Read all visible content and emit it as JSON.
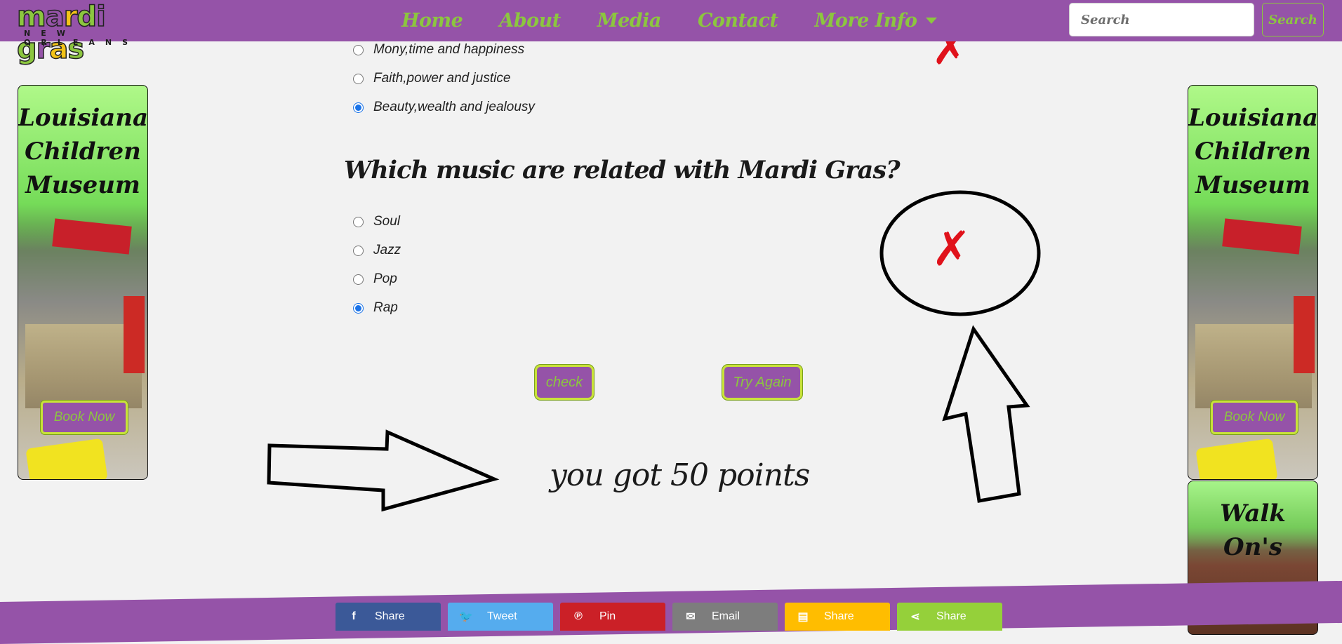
{
  "brand": {
    "logo_text": "mardi gras",
    "logo_subtitle": "NEW ORLEANS"
  },
  "nav": {
    "items": [
      {
        "label": "Home"
      },
      {
        "label": "About"
      },
      {
        "label": "Media"
      },
      {
        "label": "Contact"
      }
    ],
    "more_label": "More Info"
  },
  "search": {
    "placeholder": "Search",
    "button_label": "Search"
  },
  "ads": {
    "left": {
      "title_lines": [
        "Louisiana",
        "Children",
        "Museum"
      ],
      "button_label": "Book Now"
    },
    "right": {
      "title_lines": [
        "Louisiana",
        "Children",
        "Museum"
      ],
      "button_label": "Book Now"
    },
    "right_bottom": {
      "title": "Walk On's"
    }
  },
  "quiz": {
    "previous_options": [
      {
        "label": "Mony,time and happiness",
        "checked": false
      },
      {
        "label": "Faith,power and justice",
        "checked": false
      },
      {
        "label": "Beauty,wealth and jealousy",
        "checked": true
      }
    ],
    "question": "Which music are related with Mardi Gras?",
    "options": [
      {
        "label": "Soul",
        "checked": false
      },
      {
        "label": "Jazz",
        "checked": false
      },
      {
        "label": "Pop",
        "checked": false
      },
      {
        "label": "Rap",
        "checked": true
      }
    ],
    "check_label": "check",
    "try_again_label": "Try Again",
    "score_text": "you got 50 points",
    "wrong_mark": "✗"
  },
  "share": [
    {
      "label": "Share",
      "icon": "facebook-icon",
      "glyph": "f",
      "color": "#3b5998"
    },
    {
      "label": "Tweet",
      "icon": "twitter-icon",
      "glyph": "🐦",
      "color": "#55acee"
    },
    {
      "label": "Pin",
      "icon": "pinterest-icon",
      "glyph": "℗",
      "color": "#cb2027"
    },
    {
      "label": "Email",
      "icon": "email-icon",
      "glyph": "✉",
      "color": "#7d7d7d"
    },
    {
      "label": "Share",
      "icon": "sms-icon",
      "glyph": "▤",
      "color": "#ffbd00"
    },
    {
      "label": "Share",
      "icon": "share-icon",
      "glyph": "⋖",
      "color": "#95d03a"
    }
  ],
  "colors": {
    "brand_purple": "#9553a8",
    "accent_green": "#8cc63f",
    "wrong_red": "#e0121b"
  }
}
